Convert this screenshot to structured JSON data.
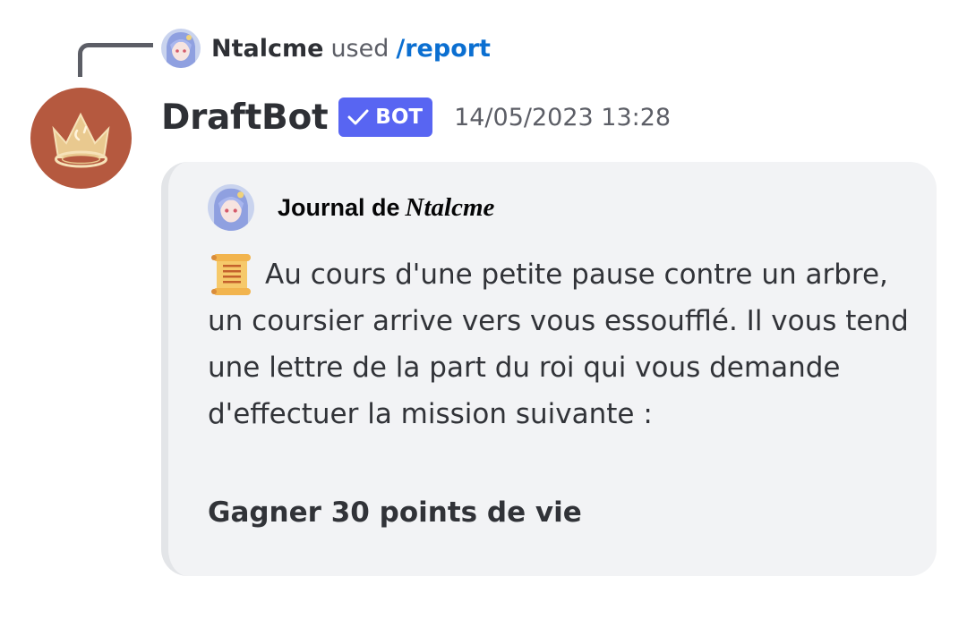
{
  "reply": {
    "username": "Ntalcme",
    "used_text": "used",
    "command": "/report",
    "avatar_icon": "anime-avatar-icon"
  },
  "message": {
    "author": "DraftBot",
    "badge": "BOT",
    "timestamp": "14/05/2023 13:28",
    "avatar_icon": "crown-icon",
    "avatar_color": "#b5593f"
  },
  "embed": {
    "author_prefix": "Journal de",
    "author_name": "Ntalcme",
    "description_icon": "scroll-icon",
    "description": "Au cours d'une petite pause contre un arbre, un coursier arrive vers vous essoufflé. Il vous tend une lettre de la part du roi qui vous demande d'effectuer la mission suivante :",
    "mission": "Gagner 30 points de vie"
  },
  "colors": {
    "badge": "#5865f2",
    "command_link": "#0b6fd1",
    "embed_background": "#f2f3f5"
  }
}
